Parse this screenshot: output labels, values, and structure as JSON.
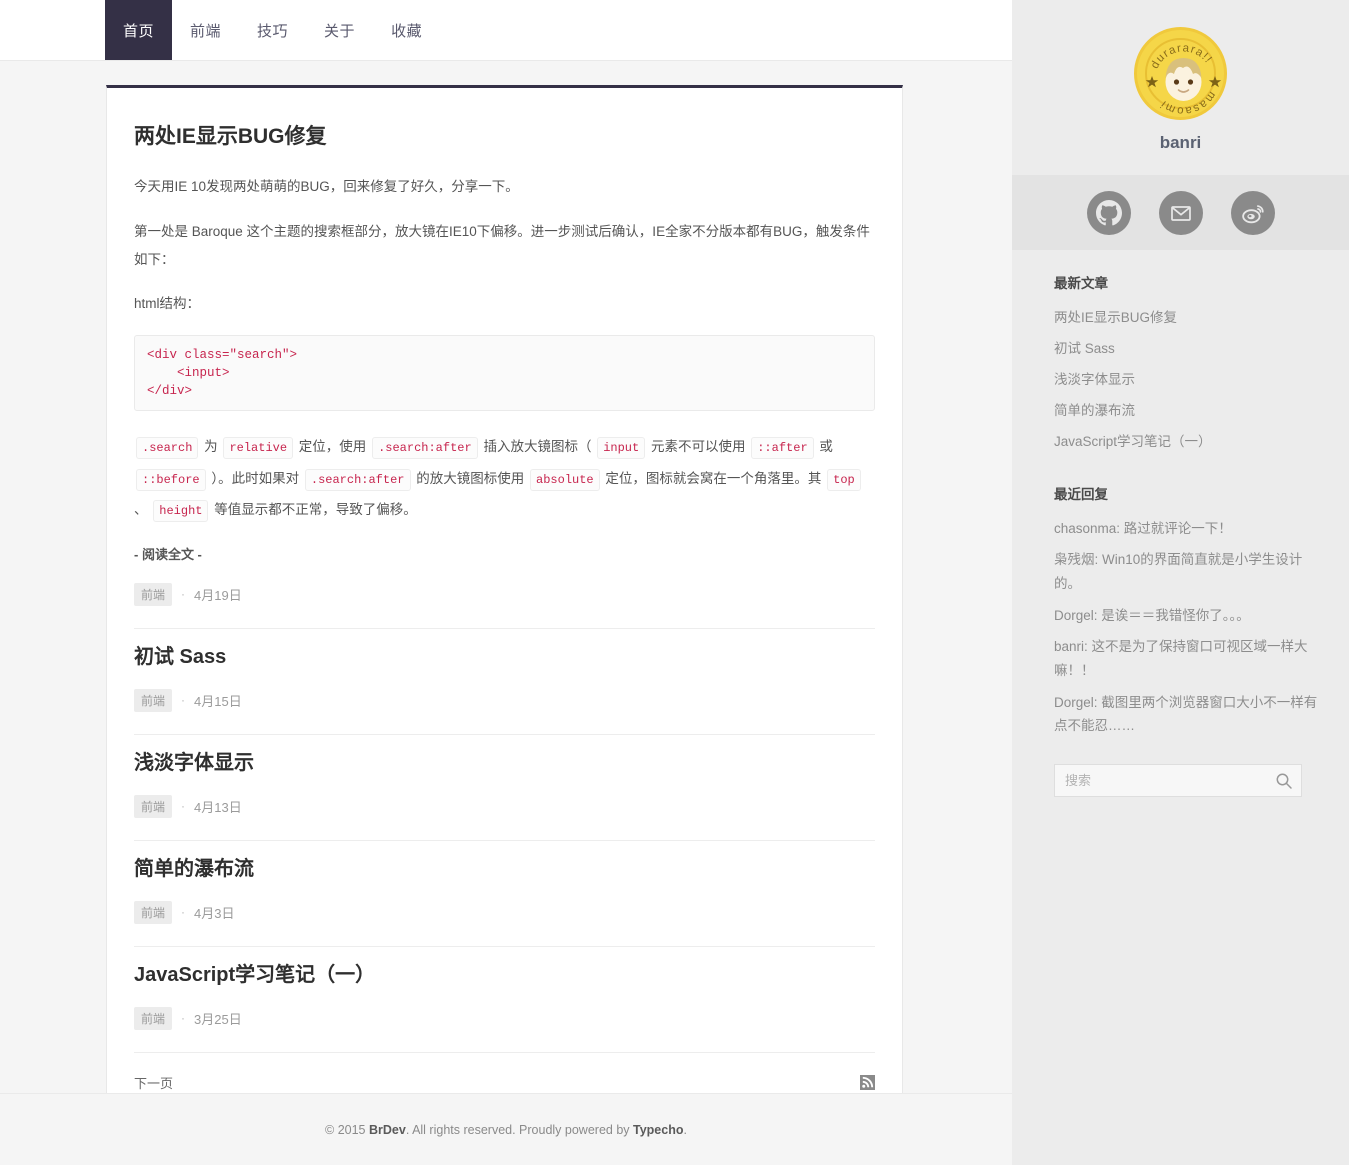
{
  "nav": {
    "items": [
      {
        "label": "首页",
        "active": true
      },
      {
        "label": "前端",
        "active": false
      },
      {
        "label": "技巧",
        "active": false
      },
      {
        "label": "关于",
        "active": false
      },
      {
        "label": "收藏",
        "active": false
      }
    ]
  },
  "main": {
    "featured_post": {
      "title": "两处IE显示BUG修复",
      "para1": "今天用IE 10发现两处萌萌的BUG，回来修复了好久，分享一下。",
      "para2": "第一处是 Baroque 这个主题的搜索框部分，放大镜在IE10下偏移。进一步测试后确认，IE全家不分版本都有BUG，触发条件如下：",
      "para3": "html结构：",
      "code": "<div class=\"search\">\n    <input>\n</div>",
      "inline_para": {
        "c1": ".search",
        "t1": " 为 ",
        "c2": "relative",
        "t2": " 定位，使用 ",
        "c3": ".search:after",
        "t3": " 插入放大镜图标（ ",
        "c4": "input",
        "t4": " 元素不可以使用 ",
        "c5": "::after",
        "t5": " 或 ",
        "c6": "::before",
        "t6": " ）。此时如果对 ",
        "c7": ".search:after",
        "t7": " 的放大镜图标使用 ",
        "c8": "absolute",
        "t8": " 定位，图标就会窝在一个角落里。其 ",
        "c9": "top",
        "t9": " 、 ",
        "c10": "height",
        "t10": " 等值显示都不正常，导致了偏移。"
      },
      "read_more": "- 阅读全文 -",
      "category": "前端",
      "separator": "·",
      "date": "4月19日"
    },
    "posts": [
      {
        "title": "初试 Sass",
        "category": "前端",
        "separator": "·",
        "date": "4月15日"
      },
      {
        "title": "浅淡字体显示",
        "category": "前端",
        "separator": "·",
        "date": "4月13日"
      },
      {
        "title": "简单的瀑布流",
        "category": "前端",
        "separator": "·",
        "date": "4月3日"
      },
      {
        "title": "JavaScript学习笔记（一）",
        "category": "前端",
        "separator": "·",
        "date": "3月25日"
      }
    ],
    "pager": {
      "next_label": "下一页",
      "rss_icon": "rss-icon"
    }
  },
  "footer": {
    "copyright_prefix": "© 2015 ",
    "site_name": "BrDev",
    "middle_text": ". All rights reserved. Proudly powered by ",
    "platform": "Typecho",
    "suffix": "."
  },
  "sidebar": {
    "avatar": {
      "icon": "avatar-durarara-badge",
      "top_text": "durarara!!",
      "bottom_text": "masaomi"
    },
    "username": "banri",
    "social": [
      {
        "icon": "github-icon",
        "name": "github"
      },
      {
        "icon": "email-icon",
        "name": "email"
      },
      {
        "icon": "weibo-icon",
        "name": "weibo"
      }
    ],
    "recent_posts": {
      "title": "最新文章",
      "items": [
        "两处IE显示BUG修复",
        "初试 Sass",
        "浅淡字体显示",
        "简单的瀑布流",
        "JavaScript学习笔记（一）"
      ]
    },
    "recent_comments": {
      "title": "最近回复",
      "items": [
        "chasonma: 路过就评论一下！",
        "枭残烟: Win10的界面简直就是小学生设计的。",
        "Dorgel: 是诶＝＝我错怪你了。。。",
        "banri: 这不是为了保持窗口可视区域一样大嘛！！",
        "Dorgel: 截图里两个浏览器窗口大小不一样有点不能忍……"
      ]
    },
    "search": {
      "placeholder": "搜索",
      "value": "",
      "icon": "search-icon"
    }
  },
  "colors": {
    "nav_active_bg": "#343046",
    "page_bg": "#f5f5f5",
    "sidebar_bg": "#ececec",
    "social_bg": "#e3e3e3",
    "code_text": "#c7254e",
    "avatar_yellow": "#f5d648"
  }
}
